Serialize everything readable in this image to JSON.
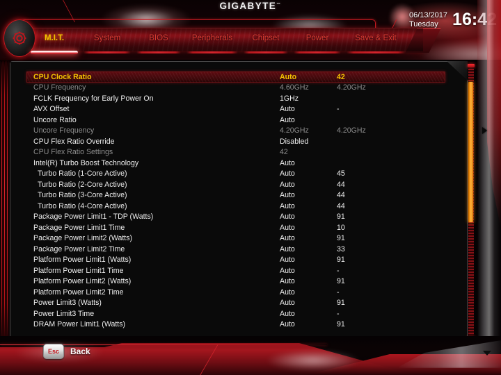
{
  "brand": {
    "name": "GIGABYTE",
    "tm": "™"
  },
  "clock": {
    "date": "06/13/2017",
    "day": "Tuesday",
    "time": "16:42"
  },
  "nav": {
    "badge_icon": "gear-icon",
    "tabs": [
      {
        "label": "M.I.T.",
        "active": true
      },
      {
        "label": "System",
        "active": false
      },
      {
        "label": "BIOS",
        "active": false
      },
      {
        "label": "Peripherals",
        "active": false
      },
      {
        "label": "Chipset",
        "active": false
      },
      {
        "label": "Power",
        "active": false
      },
      {
        "label": "Save & Exit",
        "active": false
      }
    ]
  },
  "settings": {
    "rows": [
      {
        "label": "CPU Clock Ratio",
        "v1": "Auto",
        "v2": "42",
        "state": "selected",
        "indent": false
      },
      {
        "label": "CPU Frequency",
        "v1": "4.60GHz",
        "v2": "4.20GHz",
        "state": "dim",
        "indent": false
      },
      {
        "label": "FCLK Frequency for Early Power On",
        "v1": "1GHz",
        "v2": "",
        "state": "normal",
        "indent": false
      },
      {
        "label": "AVX Offset",
        "v1": "Auto",
        "v2": "-",
        "state": "normal",
        "indent": false
      },
      {
        "label": "Uncore Ratio",
        "v1": "Auto",
        "v2": "",
        "state": "normal",
        "indent": false
      },
      {
        "label": "Uncore Frequency",
        "v1": "4.20GHz",
        "v2": "4.20GHz",
        "state": "dim",
        "indent": false
      },
      {
        "label": "CPU Flex Ratio Override",
        "v1": "Disabled",
        "v2": "",
        "state": "normal",
        "indent": false
      },
      {
        "label": "CPU Flex Ratio Settings",
        "v1": "42",
        "v2": "",
        "state": "dim",
        "indent": false
      },
      {
        "label": "Intel(R) Turbo Boost Technology",
        "v1": "Auto",
        "v2": "",
        "state": "normal",
        "indent": false
      },
      {
        "label": "Turbo Ratio (1-Core Active)",
        "v1": "Auto",
        "v2": "45",
        "state": "normal",
        "indent": true
      },
      {
        "label": "Turbo Ratio (2-Core Active)",
        "v1": "Auto",
        "v2": "44",
        "state": "normal",
        "indent": true
      },
      {
        "label": "Turbo Ratio (3-Core Active)",
        "v1": "Auto",
        "v2": "44",
        "state": "normal",
        "indent": true
      },
      {
        "label": "Turbo Ratio (4-Core Active)",
        "v1": "Auto",
        "v2": "44",
        "state": "normal",
        "indent": true
      },
      {
        "label": "Package Power Limit1 - TDP (Watts)",
        "v1": "Auto",
        "v2": "91",
        "state": "normal",
        "indent": false
      },
      {
        "label": "Package Power Limit1 Time",
        "v1": "Auto",
        "v2": "10",
        "state": "normal",
        "indent": false
      },
      {
        "label": "Package Power Limit2 (Watts)",
        "v1": "Auto",
        "v2": "91",
        "state": "normal",
        "indent": false
      },
      {
        "label": "Package Power Limit2 Time",
        "v1": "Auto",
        "v2": "33",
        "state": "normal",
        "indent": false
      },
      {
        "label": "Platform Power Limit1 (Watts)",
        "v1": "Auto",
        "v2": "91",
        "state": "normal",
        "indent": false
      },
      {
        "label": "Platform Power Limit1 Time",
        "v1": "Auto",
        "v2": "-",
        "state": "normal",
        "indent": false
      },
      {
        "label": "Platform Power Limit2 (Watts)",
        "v1": "Auto",
        "v2": "91",
        "state": "normal",
        "indent": false
      },
      {
        "label": "Platform Power Limit2 Time",
        "v1": "Auto",
        "v2": "-",
        "state": "normal",
        "indent": false
      },
      {
        "label": "Power Limit3 (Watts)",
        "v1": "Auto",
        "v2": "91",
        "state": "normal",
        "indent": false
      },
      {
        "label": "Power Limit3 Time",
        "v1": "Auto",
        "v2": "-",
        "state": "normal",
        "indent": false
      },
      {
        "label": "DRAM Power Limit1 (Watts)",
        "v1": "Auto",
        "v2": "91",
        "state": "normal",
        "indent": false
      }
    ]
  },
  "footer": {
    "esc_key": "Esc",
    "back_label": "Back"
  },
  "colors": {
    "accent_red": "#c4151c",
    "highlight_text": "#f5c400",
    "scrollbar_thumb": "#ff9f18",
    "text_normal": "#efefef",
    "text_dim": "#8d8d8d"
  }
}
